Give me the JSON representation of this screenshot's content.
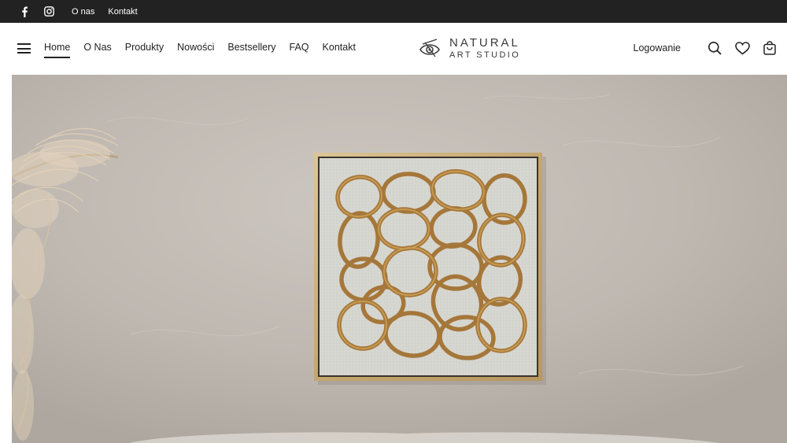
{
  "topbar": {
    "icons": [
      "facebook-icon",
      "instagram-icon"
    ],
    "links": [
      "O nas",
      "Kontakt"
    ]
  },
  "header": {
    "nav": [
      "Home",
      "O Nas",
      "Produkty",
      "Nowości",
      "Bestsellery",
      "FAQ",
      "Kontakt"
    ],
    "active_nav": "Home",
    "logo": {
      "line1": "NATURAL",
      "line2": "ART STUDIO"
    },
    "login_label": "Logowanie",
    "tool_icons": [
      "search-icon",
      "heart-icon",
      "cart-icon"
    ]
  },
  "colors": {
    "topbar_bg": "#222222",
    "text": "#222222",
    "hero_wall": "#c3bcb5",
    "frame_gold": "#c9ad7a",
    "canvas_linen": "#d9d9d4",
    "rattan": "#a0743a"
  },
  "hero": {
    "image": "wall-art-rattan-rings"
  }
}
